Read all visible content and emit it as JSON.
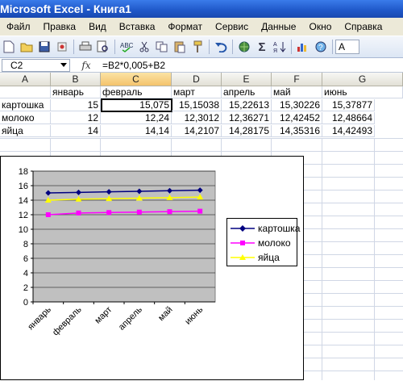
{
  "window": {
    "title": "Microsoft Excel - Книга1"
  },
  "menu": [
    "Файл",
    "Правка",
    "Вид",
    "Вставка",
    "Формат",
    "Сервис",
    "Данные",
    "Окно",
    "Справка"
  ],
  "toolbar": {
    "icons": [
      "new-icon",
      "open-icon",
      "save-icon",
      "permission-icon",
      "print-icon",
      "print-preview-icon",
      "spelling-icon",
      "cut-icon",
      "copy-icon",
      "paste-icon",
      "format-painter-icon",
      "undo-icon",
      "hyperlink-icon",
      "autosum-icon",
      "sort-icon",
      "chart-wizard-icon",
      "help-icon"
    ],
    "autosum_glyph": "Σ",
    "font_box": "A"
  },
  "formula_bar": {
    "name_box": "C2",
    "fx": "fx",
    "formula": "=B2*0,005+B2"
  },
  "sheet": {
    "columns": [
      "A",
      "B",
      "C",
      "D",
      "E",
      "F",
      "G"
    ],
    "selected_column": "C",
    "selected_cell": "C2",
    "rows": [
      [
        "",
        "январь",
        "февраль",
        "март",
        "апрель",
        "май",
        "июнь"
      ],
      [
        "картошка",
        "15",
        "15,075",
        "15,15038",
        "15,22613",
        "15,30226",
        "15,37877"
      ],
      [
        "молоко",
        "12",
        "12,24",
        "12,3012",
        "12,36271",
        "12,42452",
        "12,48664"
      ],
      [
        "яйца",
        "14",
        "14,14",
        "14,2107",
        "14,28175",
        "14,35316",
        "14,42493"
      ]
    ]
  },
  "chart_data": {
    "type": "line",
    "categories": [
      "январь",
      "февраль",
      "март",
      "апрель",
      "май",
      "июнь"
    ],
    "series": [
      {
        "name": "картошка",
        "values": [
          15,
          15.075,
          15.15038,
          15.22613,
          15.30226,
          15.37877
        ],
        "color": "#000080",
        "marker": "diamond"
      },
      {
        "name": "молоко",
        "values": [
          12,
          12.24,
          12.3012,
          12.36271,
          12.42452,
          12.48664
        ],
        "color": "#ff00ff",
        "marker": "square"
      },
      {
        "name": "яйца",
        "values": [
          14,
          14.14,
          14.2107,
          14.28175,
          14.35316,
          14.42493
        ],
        "color": "#ffff00",
        "marker": "triangle"
      }
    ],
    "ylim": [
      0,
      18
    ],
    "y_ticks": [
      "0",
      "2",
      "4",
      "6",
      "8",
      "10",
      "12",
      "14",
      "16",
      "18"
    ],
    "legend_position": "right",
    "grid": true,
    "plot_background": "#c0c0c0"
  }
}
